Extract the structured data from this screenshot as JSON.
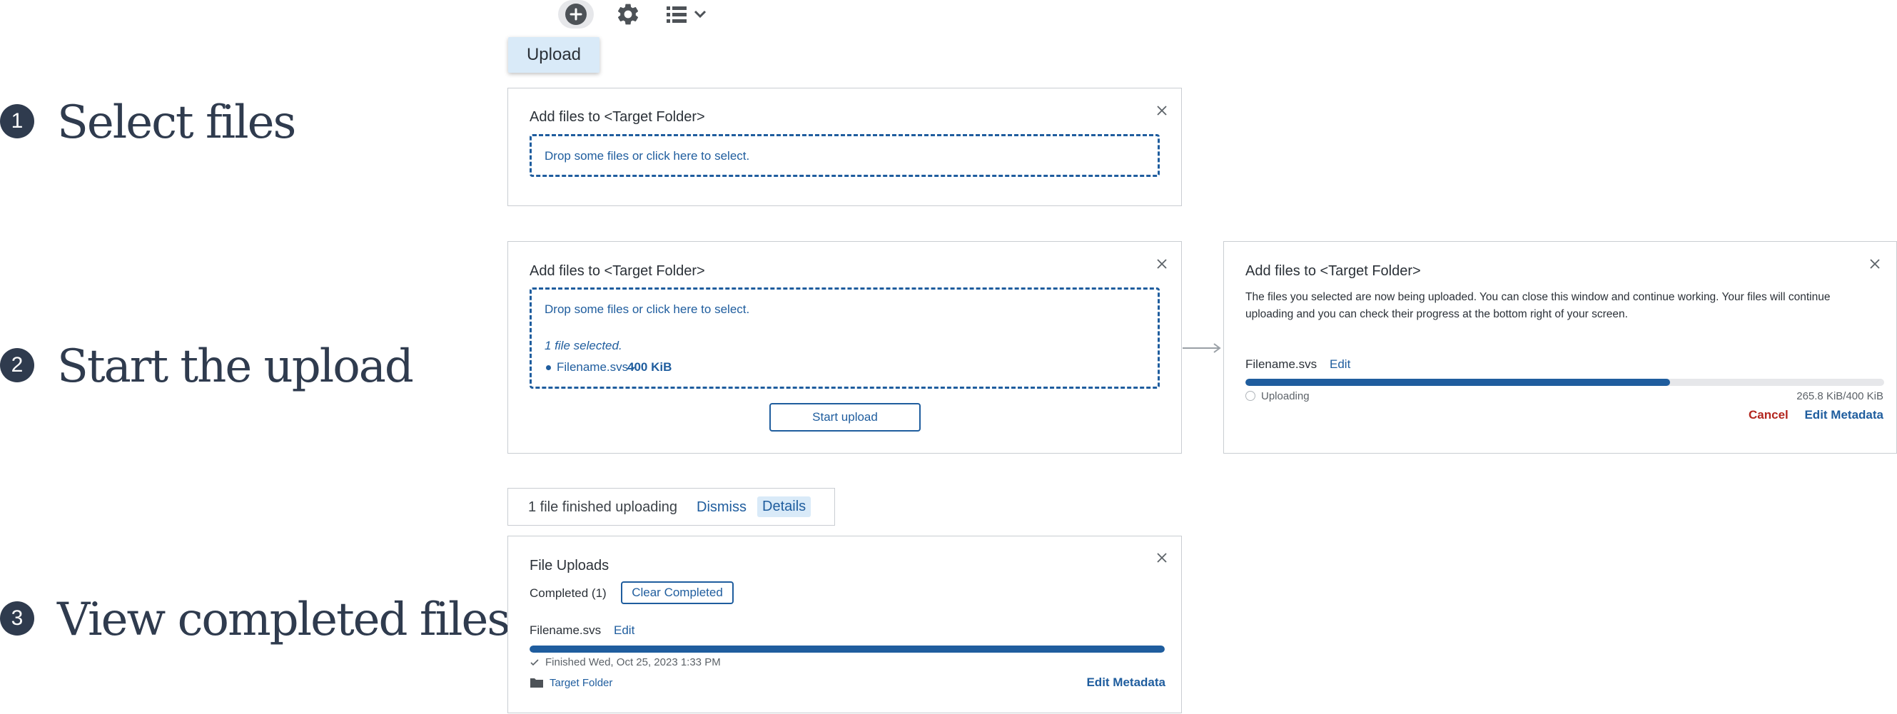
{
  "steps": [
    {
      "number": "1",
      "title": "Select files"
    },
    {
      "number": "2",
      "title": "Start the upload"
    },
    {
      "number": "3",
      "title": "View completed files"
    }
  ],
  "toolbar": {
    "icons": [
      "plus-circle-icon",
      "gear-icon",
      "list-view-icon",
      "chevron-down-icon"
    ],
    "upload_menu_label": "Upload"
  },
  "card1": {
    "title": "Add files to <Target Folder>",
    "dropzone_text": "Drop some files or click here to select."
  },
  "card2": {
    "title": "Add files to <Target Folder>",
    "dropzone_text": "Drop some files or click here to select.",
    "selected_count": "1 file selected.",
    "file_name": "Filename.svs - ",
    "file_size": "400 KiB",
    "start_button": "Start upload"
  },
  "card_progress": {
    "title": "Add files to <Target Folder>",
    "message": "The files you selected are now being uploaded. You can close this window and continue working. Your files will continue uploading and you can check their progress at the bottom right of your screen.",
    "file_name": "Filename.svs",
    "edit_link": "Edit",
    "progress": 0.6645,
    "status": "Uploading",
    "size_progress": "265.8 KiB/400 KiB",
    "cancel_link": "Cancel",
    "edit_metadata_link": "Edit Metadata"
  },
  "toast": {
    "message": "1 file finished uploading",
    "dismiss": "Dismiss",
    "details": "Details"
  },
  "uploads": {
    "title": "File Uploads",
    "completed_label": "Completed (1)",
    "clear_button": "Clear Completed",
    "file_name": "Filename.svs",
    "edit_link": "Edit",
    "progress": 1.0,
    "finished_text": "Finished Wed, Oct 25, 2023 1:33 PM",
    "folder_link": "Target Folder",
    "edit_metadata_link": "Edit Metadata"
  },
  "colors": {
    "accent": "#1f5d9e",
    "danger": "#b3261e",
    "step_badge": "#2f3b4e"
  }
}
